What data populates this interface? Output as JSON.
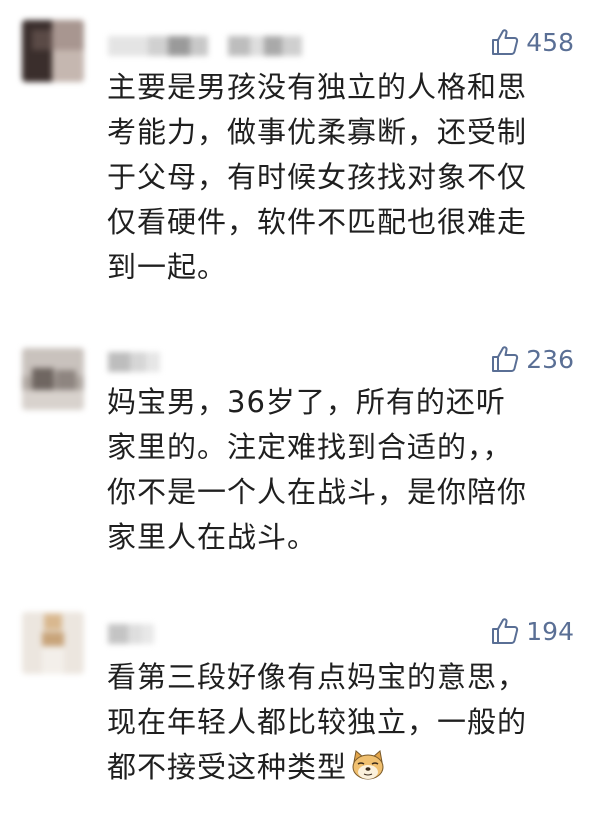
{
  "comments": [
    {
      "likes": "458",
      "text": "主要是男孩没有独立的人格和思\n考能力，做事优柔寡断，还受制\n于父母，有时候女孩找对象不仅\n仅看硬件，软件不匹配也很难走\n到一起。"
    },
    {
      "likes": "236",
      "text": "妈宝男，36岁了，所有的还听\n家里的。注定难找到合适的，，\n你不是一个人在战斗，是你陪你\n家里人在战斗。"
    },
    {
      "likes": "194",
      "text": "看第三段好像有点妈宝的意思，\n现在年轻人都比较独立，一般的\n都不接受这种类型"
    }
  ],
  "colors": {
    "like_icon": "#5a6f95",
    "text": "#1f1f1f"
  },
  "icons": {
    "like": "thumbs-up-icon",
    "emoji": "doge-emoji-icon"
  }
}
